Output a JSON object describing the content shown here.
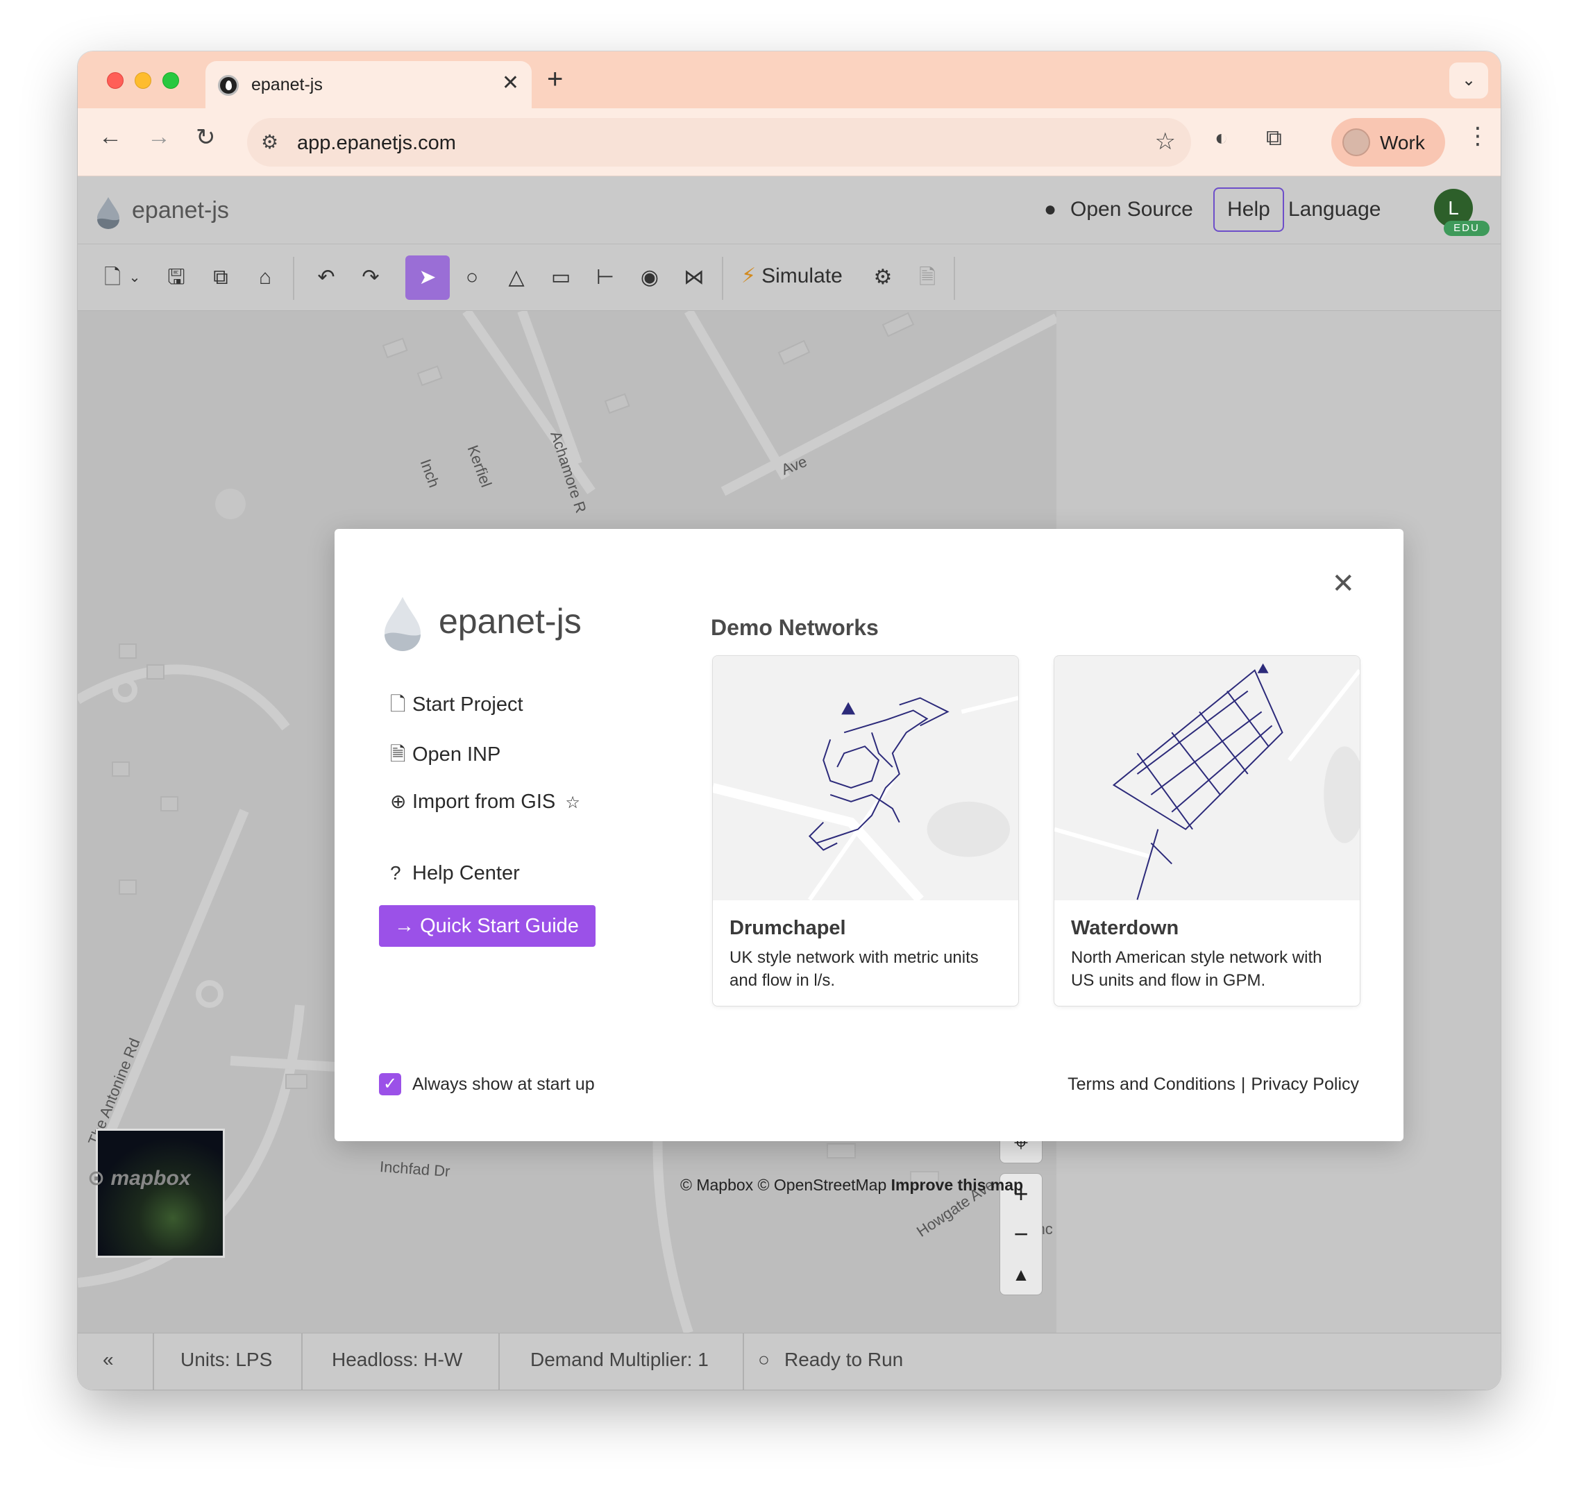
{
  "browser": {
    "tab_title": "epanet-js",
    "url": "app.epanetjs.com",
    "profile_label": "Work"
  },
  "app": {
    "title": "epanet-js",
    "header": {
      "open_source": "Open Source",
      "help": "Help",
      "language": "Language",
      "avatar_initial": "L",
      "avatar_badge": "EDU"
    },
    "toolbar": {
      "simulate": "Simulate",
      "icons": [
        "new-file-icon",
        "save-icon",
        "save-as-icon",
        "home-icon",
        "undo-icon",
        "redo-icon",
        "select-icon",
        "junction-icon",
        "reservoir-icon",
        "tank-icon",
        "pipe-icon",
        "pump-icon",
        "valve-icon",
        "simulate-icon",
        "settings-icon",
        "report-icon"
      ]
    },
    "map": {
      "streets": [
        "Achamore R",
        "Kerfiel",
        "Inch",
        "Ave",
        "The Antonine Rd",
        "Inchfad Dr",
        "Howgate Ave",
        "Drumc"
      ],
      "attribution_prefix": "© Mapbox © OpenStreetMap",
      "attribution_link": "Improve this map",
      "mapbox_logo": "mapbox"
    },
    "statusbar": {
      "collapse": "«",
      "units": "Units: LPS",
      "headloss": "Headloss: H-W",
      "demand": "Demand Multiplier: 1",
      "run_status": "Ready to Run"
    }
  },
  "modal": {
    "brand": "epanet-js",
    "menu": {
      "start_project": "Start Project",
      "open_inp": "Open INP",
      "import_gis": "Import from GIS",
      "help_center": "Help Center"
    },
    "quick_start": "Quick Start Guide",
    "demo_heading": "Demo Networks",
    "demos": [
      {
        "title": "Drumchapel",
        "description": "UK style network with metric units and flow in l/s."
      },
      {
        "title": "Waterdown",
        "description": "North American style network with US units and flow in GPM."
      }
    ],
    "always_show": "Always show at start up",
    "terms": "Terms and Conditions",
    "privacy": "Privacy Policy"
  },
  "colors": {
    "accent": "#9b51e8",
    "tab_strip": "#fbd3c0",
    "network": "#2c2a7a"
  }
}
